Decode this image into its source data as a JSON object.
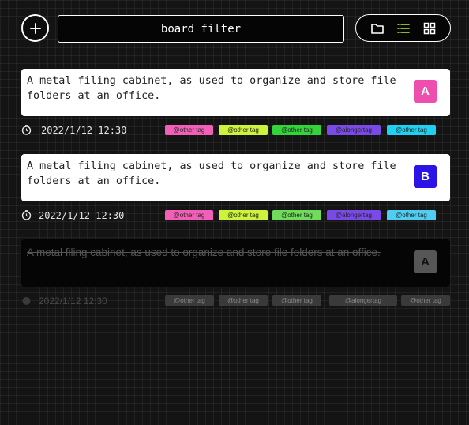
{
  "header": {
    "filter_placeholder": "board filter",
    "add_icon": "plus-icon",
    "view_icons": [
      "folder-icon",
      "list-icon",
      "grid-icon"
    ],
    "active_view_color": "#b5f23d"
  },
  "cards": [
    {
      "text": "A metal filing cabinet, as used to organize and store file folders at an office.",
      "badge": "A",
      "badge_color": "#ee4fae",
      "date": "2022/1/12 12:30",
      "done": false,
      "tags": [
        {
          "label": "@other tag",
          "color": "#f25fb6"
        },
        {
          "label": "@other tag",
          "color": "#cdf33a"
        },
        {
          "label": "@other tag",
          "color": "#33d43a"
        },
        {
          "label": "@alongertag",
          "color": "#7a4ae8"
        },
        {
          "label": "@other tag",
          "color": "#1fd1f0"
        }
      ]
    },
    {
      "text": "A metal filing cabinet, as used to organize and store file folders at an office.",
      "badge": "B",
      "badge_color": "#2a14e6",
      "date": "2022/1/12 12:30",
      "done": false,
      "tags": [
        {
          "label": "@other tag",
          "color": "#f25fb6"
        },
        {
          "label": "@other tag",
          "color": "#cdf33a"
        },
        {
          "label": "@other tag",
          "color": "#6fdc5a"
        },
        {
          "label": "@alongertag",
          "color": "#7a4ae8"
        },
        {
          "label": "@other tag",
          "color": "#4fcdf3"
        }
      ]
    },
    {
      "text": "A metal filing cabinet, as used to organize and store file folders at an office.",
      "badge": "A",
      "badge_color": "#565656",
      "date": "2022/1/12 12:30",
      "done": true,
      "tags": [
        {
          "label": "@other tag",
          "color": "#3a3a3a"
        },
        {
          "label": "@other tag",
          "color": "#3a3a3a"
        },
        {
          "label": "@other tag",
          "color": "#3a3a3a"
        },
        {
          "label": "@alongertag",
          "color": "#3a3a3a"
        },
        {
          "label": "@other tag",
          "color": "#3a3a3a"
        }
      ]
    }
  ]
}
